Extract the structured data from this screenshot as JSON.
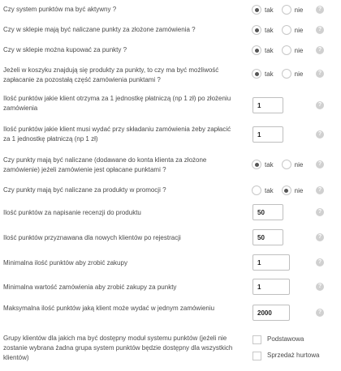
{
  "radio_options": {
    "yes": "tak",
    "no": "nie"
  },
  "help_icon": "question-circle-icon",
  "settings": [
    {
      "label": "Czy system punktów ma być aktywny ?",
      "type": "radio",
      "selected": "tak",
      "help": true
    },
    {
      "label": "Czy w sklepie mają być naliczane punkty za złożone zamówienia ?",
      "type": "radio",
      "selected": "tak",
      "help": true
    },
    {
      "label": "Czy w sklepie można kupować za punkty ?",
      "type": "radio",
      "selected": "tak",
      "help": true
    },
    {
      "label": "Jeżeli w koszyku znajdują się produkty za punkty, to czy ma być możliwość zapłacanie za pozostałą część zamówienia punktami ?",
      "type": "radio",
      "selected": "tak",
      "help": true
    },
    {
      "label": "Ilość punktów jakie klient otrzyma za 1 jednostkę płatniczą (np 1 zł) po złożeniu zamówienia",
      "type": "number",
      "value": "1",
      "help": true
    },
    {
      "label": "Ilość punktów jakie klient musi wydać przy składaniu zamówienia żeby zapłacić za 1 jednostkę płatniczą (np 1 zł)",
      "type": "number",
      "value": "1",
      "help": true
    },
    {
      "label": "Czy punkty mają być naliczane (dodawane do konta klienta za złożone zamówienie) jeżeli zamówienie jest opłacane punktami ?",
      "type": "radio",
      "selected": "tak",
      "help": true
    },
    {
      "label": "Czy punkty mają być naliczane za produkty w promocji ?",
      "type": "radio",
      "selected": "nie",
      "help": true
    },
    {
      "label": "Ilość punktów za napisanie recenzji do produktu",
      "type": "number",
      "value": "50",
      "help": true
    },
    {
      "label": "Ilość punktów przyznawana dla nowych klientów po rejestracji",
      "type": "number",
      "value": "50",
      "help": true
    },
    {
      "label": "Minimalna ilość punktów aby zrobić zakupy",
      "type": "number",
      "value": "1",
      "help": true
    },
    {
      "label": "Minimalna wartość zamówienia aby zrobić zakupy za punkty",
      "type": "number",
      "value": "1",
      "help": true
    },
    {
      "label": "Maksymalna ilość punktów jaką klient może wydać w jednym zamówieniu",
      "type": "number",
      "value": "2000",
      "help": true
    },
    {
      "label": "Grupy klientów dla jakich ma być dostępny moduł systemu punktów (jeżeli nie zostanie wybrana żadna grupa system punktów będzie dostępny dla wszystkich klientów)",
      "type": "checkbox",
      "options": [
        {
          "label": "Podstawowa",
          "checked": false
        },
        {
          "label": "Sprzedaż hurtowa",
          "checked": false
        }
      ]
    }
  ]
}
